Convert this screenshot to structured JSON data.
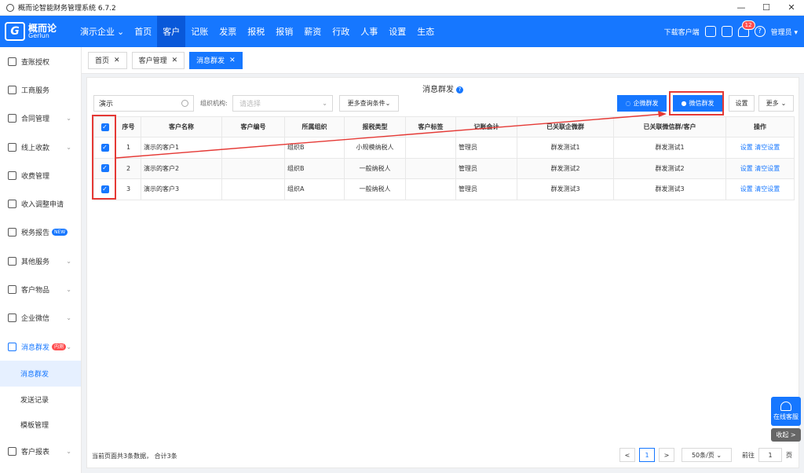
{
  "window": {
    "title": "概而论智能财务管理系统 6.7.2",
    "controls": [
      "—",
      "☐",
      "✕"
    ]
  },
  "topnav": {
    "logo_cn": "概而论",
    "logo_en": "Gerlun",
    "company": "演示企业",
    "menu": [
      "首页",
      "客户",
      "记账",
      "发票",
      "报税",
      "报销",
      "薪资",
      "行政",
      "人事",
      "设置",
      "生态"
    ],
    "active_menu": "客户",
    "download_client": "下载客户端",
    "notification_count": "12",
    "user": "管理员"
  },
  "sidebar": {
    "items": [
      {
        "label": "查账授权",
        "chevron": false
      },
      {
        "label": "工商服务",
        "chevron": false
      },
      {
        "label": "合同管理",
        "chevron": true
      },
      {
        "label": "线上收款",
        "chevron": true
      },
      {
        "label": "收费管理",
        "chevron": false
      },
      {
        "label": "收入调整申请",
        "chevron": false
      },
      {
        "label": "税务报告",
        "chevron": false,
        "tag": "NEW",
        "tag_color": "#1677ff"
      },
      {
        "label": "其他服务",
        "chevron": true
      },
      {
        "label": "客户物品",
        "chevron": true
      },
      {
        "label": "企业微信",
        "chevron": true
      },
      {
        "label": "消息群发",
        "chevron": true,
        "tag": "内测",
        "tag_color": "#ff4d4f"
      }
    ],
    "subitems": [
      {
        "label": "消息群发",
        "active": true
      },
      {
        "label": "发送记录",
        "active": false
      },
      {
        "label": "模板管理",
        "active": false
      }
    ],
    "bottom_item": {
      "label": "客户报表",
      "chevron": true
    }
  },
  "tabs": [
    {
      "label": "首页",
      "active": false
    },
    {
      "label": "客户管理",
      "active": false
    },
    {
      "label": "消息群发",
      "active": true
    }
  ],
  "page": {
    "title": "消息群发",
    "search_value": "演示",
    "org_label": "组织机构:",
    "org_placeholder": "请选择",
    "more_query": "更多查询条件",
    "btn_wecom": "企微群发",
    "btn_wechat": "微信群发",
    "btn_settings": "设置",
    "btn_more": "更多"
  },
  "table": {
    "headers": [
      "序号",
      "客户名称",
      "客户编号",
      "所属组织",
      "报税类型",
      "客户标签",
      "记账会计",
      "已关联企微群",
      "已关联微信群/客户",
      "操作"
    ],
    "rows": [
      {
        "no": "1",
        "name": "演示的客户1",
        "code": "",
        "org": "组织B",
        "tax": "小规模纳税人",
        "tag": "",
        "accountant": "管理员",
        "wecom_group": "群发测试1",
        "wechat_group": "群发测试1",
        "op1": "设置",
        "op2": "清空设置"
      },
      {
        "no": "2",
        "name": "演示的客户2",
        "code": "",
        "org": "组织B",
        "tax": "一般纳税人",
        "tag": "",
        "accountant": "管理员",
        "wecom_group": "群发测试2",
        "wechat_group": "群发测试2",
        "op1": "设置",
        "op2": "清空设置"
      },
      {
        "no": "3",
        "name": "演示的客户3",
        "code": "",
        "org": "组织A",
        "tax": "一般纳税人",
        "tag": "",
        "accountant": "管理员",
        "wecom_group": "群发测试3",
        "wechat_group": "群发测试3",
        "op1": "设置",
        "op2": "清空设置"
      }
    ]
  },
  "footer": {
    "info": "当前页面共3条数据， 合计3条",
    "page_prev": "<",
    "page_current": "1",
    "page_next": ">",
    "page_size": "50条/页",
    "goto_label": "前往",
    "goto_value": "1",
    "goto_unit": "页"
  },
  "floating": {
    "service": "在线客服",
    "collapse": "收起 >"
  },
  "colors": {
    "primary": "#1677ff",
    "highlight": "#e53935"
  }
}
